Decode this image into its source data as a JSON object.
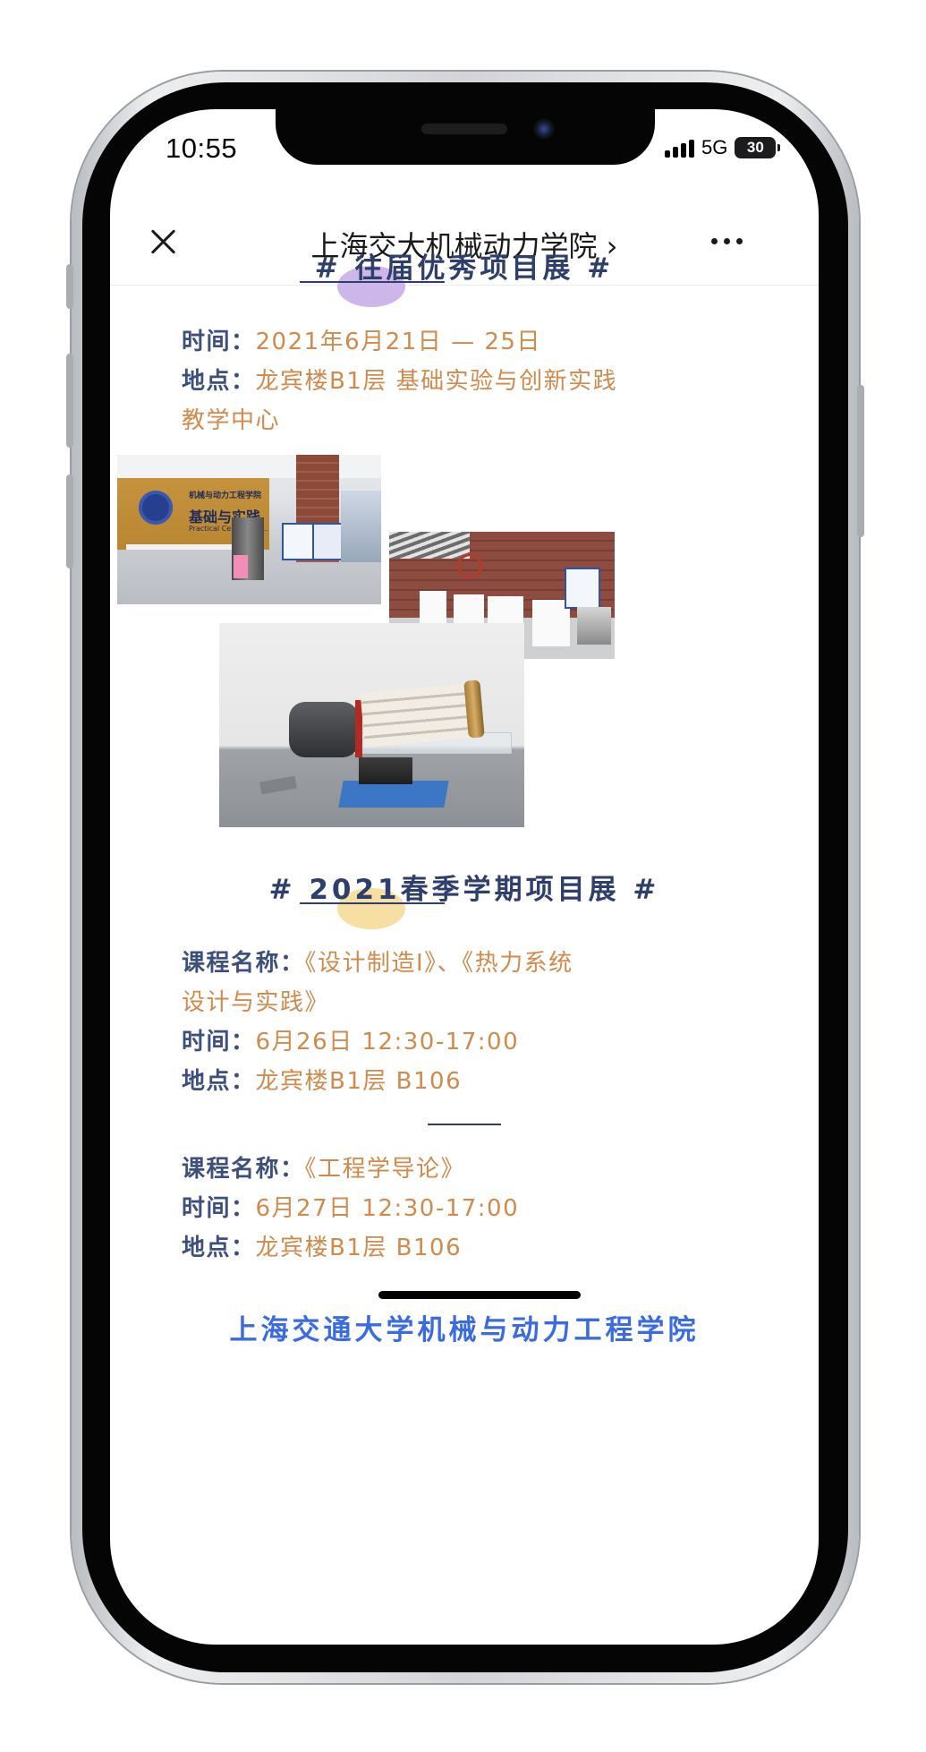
{
  "status_bar": {
    "time": "10:55",
    "network": "5G",
    "battery": "30"
  },
  "navbar": {
    "title": "上海交大机械动力学院 ›"
  },
  "section1": {
    "title": "# 往届优秀项目展 #",
    "time_label": "时间：",
    "time_value": "2021年6月21日 — 25日",
    "place_label": "地点：",
    "place_value": "龙宾楼B1层 基础实验与创新实践",
    "place_value_cont": "教学中心"
  },
  "photos": {
    "photo1_wall_line1": "机械与动力工程学院",
    "photo1_wall_line2": "基础与实践",
    "photo1_wall_line3": "Practical Center in E..."
  },
  "section2": {
    "title": "# 2021春季学期项目展 #",
    "course1_label": "课程名称：",
    "course1_value": "《设计制造Ⅰ》、《热力系统",
    "course1_value_cont": "设计与实践》",
    "time1_label": "时间：",
    "time1_value": "6月26日 12:30-17:00",
    "place1_label": "地点：",
    "place1_value": "龙宾楼B1层 B106",
    "course2_label": "课程名称：",
    "course2_value": "《工程学导论》",
    "time2_label": "时间：",
    "time2_value": "6月27日 12:30-17:00",
    "place2_label": "地点：",
    "place2_value": "龙宾楼B1层 B106"
  },
  "footer_cut_text": "上海交通大学机械与动力工程学院",
  "colors": {
    "heading": "#2f3f6b",
    "label": "#3d4f7c",
    "value": "#d08a4c",
    "blob1": "#cdb6e9",
    "blob2": "#f7dfa3"
  }
}
